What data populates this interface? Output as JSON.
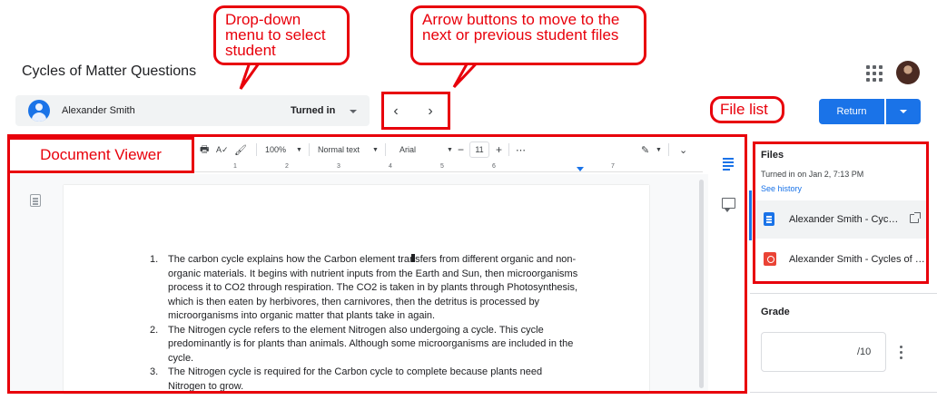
{
  "header": {
    "title": "Cycles of Matter Questions"
  },
  "student_bar": {
    "name": "Alexander Smith",
    "status": "Turned in"
  },
  "nav": {
    "prev_glyph": "‹",
    "next_glyph": "›"
  },
  "actions": {
    "return_label": "Return"
  },
  "doc_toolbar": {
    "zoom": "100%",
    "style": "Normal text",
    "font": "Arial",
    "font_size": "11",
    "minus": "−",
    "plus": "+",
    "more": "⋯"
  },
  "ruler": [
    "1",
    "2",
    "3",
    "4",
    "5",
    "6",
    "7"
  ],
  "document": {
    "items": [
      {
        "number": "1.",
        "text": "The carbon cycle explains how the Carbon element transfers from different organic and non-organic materials. It begins with nutrient inputs from the Earth and Sun, then microorganisms process it to CO2 through respiration. The CO2 is taken in by plants through Photosynthesis, which is then eaten by herbivores, then carnivores, then the detritus is processed by microorganisms into organic matter that plants take in again."
      },
      {
        "number": "2.",
        "text": "The Nitrogen cycle refers to the element Nitrogen also undergoing a cycle. This cycle predominantly is for plants than animals. Although some microorganisms are included in the cycle."
      },
      {
        "number": "3.",
        "text": "The Nitrogen cycle is required for the Carbon cycle to complete because plants need Nitrogen to grow."
      }
    ]
  },
  "files_panel": {
    "title": "Files",
    "turned_in_on": "Turned in on Jan 2, 7:13 PM",
    "see_history": "See history",
    "files": [
      {
        "name": "Alexander Smith - Cyc…",
        "icon": "google-doc-icon"
      },
      {
        "name": "Alexander Smith - Cycles of …",
        "icon": "pdf-icon"
      }
    ]
  },
  "grade": {
    "title": "Grade",
    "suffix": "/10"
  },
  "annotations": {
    "dropdown": "Drop-down menu to select student",
    "arrows": "Arrow buttons to move to the next or previous student files",
    "file_list": "File list",
    "document_viewer": "Document Viewer"
  },
  "colors": {
    "accent": "#1a73e8",
    "annotation": "#e8000b"
  }
}
